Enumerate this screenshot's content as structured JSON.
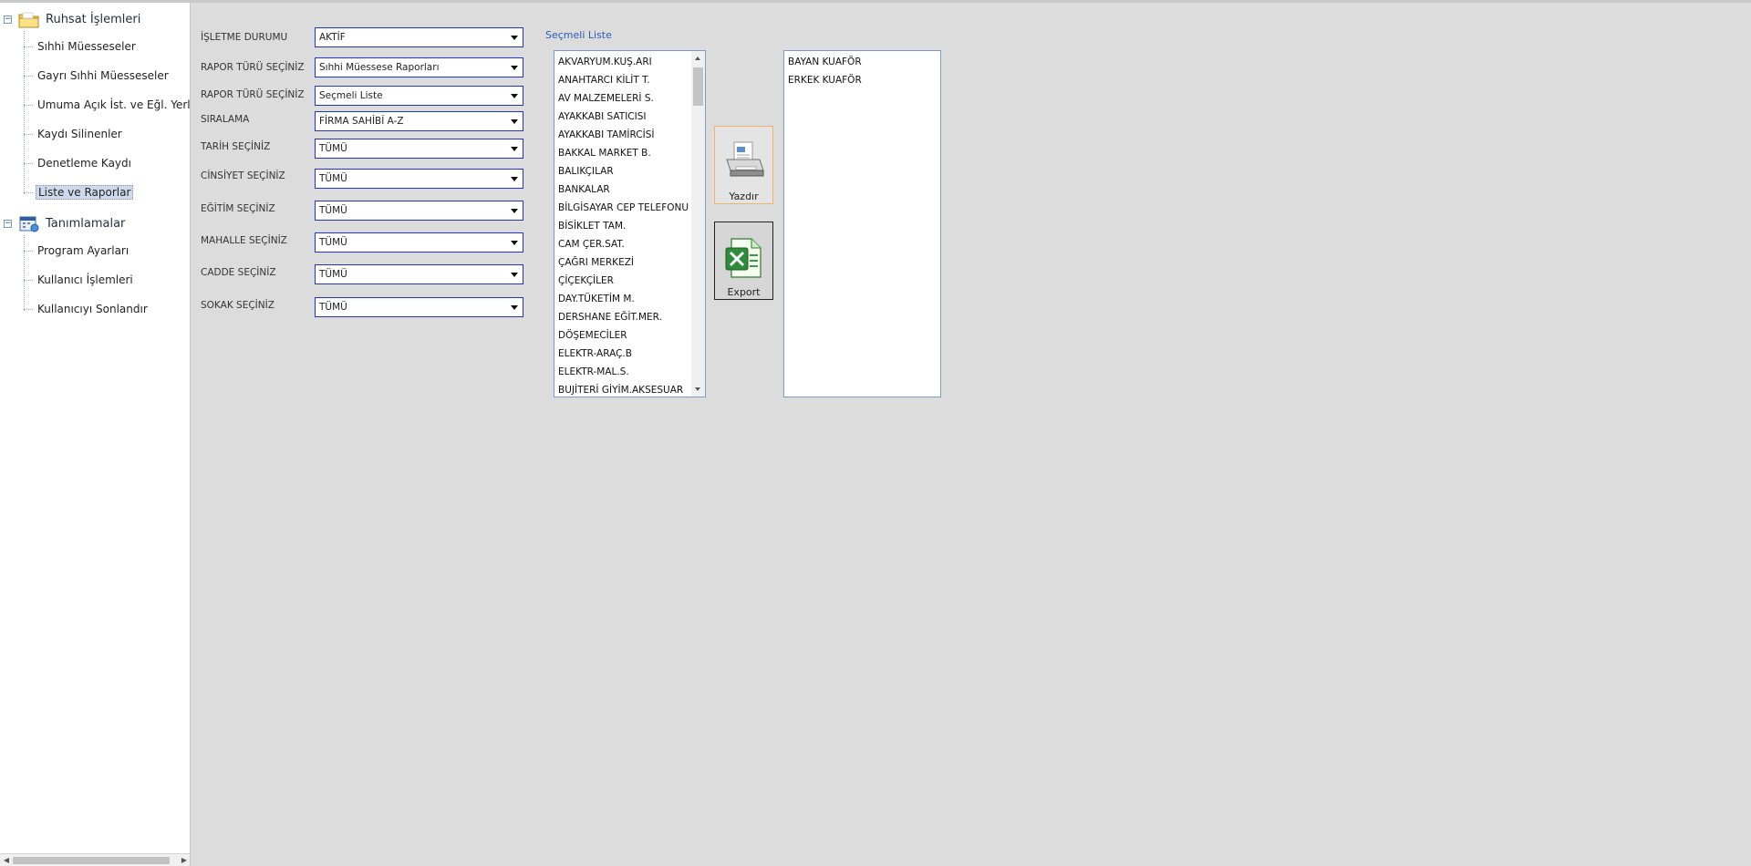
{
  "tree": {
    "groups": [
      {
        "label": "Ruhsat İşlemleri",
        "items": [
          {
            "label": "Sıhhi Müesseseler"
          },
          {
            "label": "Gayrı Sıhhi Müesseseler"
          },
          {
            "label": "Umuma Açık İst. ve Eğl. Yerleri"
          },
          {
            "label": "Kaydı Silinenler"
          },
          {
            "label": "Denetleme Kaydı"
          },
          {
            "label": "Liste ve Raporlar"
          }
        ]
      },
      {
        "label": "Tanımlamalar",
        "items": [
          {
            "label": "Program Ayarları"
          },
          {
            "label": "Kullanıcı İşlemleri"
          },
          {
            "label": "Kullanıcıyı Sonlandır"
          }
        ]
      }
    ],
    "selected": "Liste ve Raporlar"
  },
  "form": {
    "fields": [
      {
        "label": "İŞLETME DURUMU",
        "value": "AKTİF"
      },
      {
        "label": "RAPOR TÜRÜ SEÇİNİZ",
        "value": "Sıhhi Müessese Raporları"
      },
      {
        "label": "RAPOR TÜRÜ SEÇİNİZ",
        "value": "Seçmeli Liste"
      },
      {
        "label": "SIRALAMA",
        "value": "FİRMA SAHİBİ A-Z"
      },
      {
        "label": "TARİH SEÇİNİZ",
        "value": "TÜMÜ"
      },
      {
        "label": "CİNSİYET SEÇİNİZ",
        "value": "TÜMÜ"
      },
      {
        "label": "EĞİTİM SEÇİNİZ",
        "value": "TÜMÜ"
      },
      {
        "label": "MAHALLE SEÇİNİZ",
        "value": "TÜMÜ"
      },
      {
        "label": "CADDE SEÇİNİZ",
        "value": "TÜMÜ"
      },
      {
        "label": "SOKAK SEÇİNİZ",
        "value": "TÜMÜ"
      }
    ]
  },
  "selection": {
    "title": "Seçmeli Liste",
    "available": [
      "AKVARYUM.KUŞ.ARI",
      "ANAHTARCI  KİLİT  T.",
      "AV MALZEMELERİ S.",
      "AYAKKABI SATICISI",
      "AYAKKABI TAMİRCİSİ",
      "BAKKAL MARKET B.",
      "BALIKÇILAR",
      "BANKALAR",
      "BİLGİSAYAR CEP TELEFONU S",
      "BİSİKLET TAM.",
      "CAM ÇER.SAT.",
      "ÇAĞRI MERKEZİ",
      "ÇİÇEKÇİLER",
      "DAY.TÜKETİM M.",
      "DERSHANE EĞİT.MER.",
      "DÖŞEMECİLER",
      "ELEKTR-ARAÇ.B",
      "ELEKTR-MAL.S.",
      "BUJİTERİ GİYİM.AKSESUAR"
    ],
    "selected": [
      "BAYAN KUAFÖR",
      "ERKEK KUAFÖR"
    ]
  },
  "actions": {
    "print_label": "Yazdır",
    "export_label": "Export"
  },
  "icons": {
    "root1": "folder-icon",
    "root2": "calendar-settings-icon",
    "print": "printer-icon",
    "export": "excel-icon"
  }
}
